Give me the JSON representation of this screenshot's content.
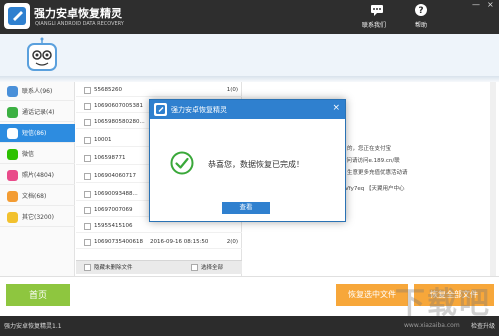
{
  "titlebar": {
    "app_name": "强力安卓恢复精灵",
    "app_subtitle": "QIANGLI ANDROID DATA RECOVERY",
    "contact_label": "联系我们",
    "help_label": "帮助",
    "minimize": "—",
    "close": "×"
  },
  "sidebar": {
    "items": [
      {
        "label": "联系人(96)",
        "icon": "contacts-icon",
        "color": "#4a90d9",
        "active": false
      },
      {
        "label": "通话记录(4)",
        "icon": "call-log-icon",
        "color": "#3cb043",
        "active": false
      },
      {
        "label": "短信(86)",
        "icon": "sms-icon",
        "color": "#ffffff",
        "active": true
      },
      {
        "label": "微信",
        "icon": "wechat-icon",
        "color": "#2dc100",
        "active": false
      },
      {
        "label": "照片(4804)",
        "icon": "photos-icon",
        "color": "#e94b8a",
        "active": false
      },
      {
        "label": "文档(68)",
        "icon": "documents-icon",
        "color": "#f39c33",
        "active": false
      },
      {
        "label": "其它(3200)",
        "icon": "other-icon",
        "color": "#f2c12e",
        "active": false
      }
    ]
  },
  "messages": {
    "rows": [
      {
        "number": "55685260",
        "date": "",
        "count": "1(0)"
      },
      {
        "number": "10690607005381",
        "date": "",
        "count": ""
      },
      {
        "number": "1065980580280...",
        "date": "",
        "count": ""
      },
      {
        "number": "10001",
        "date": "",
        "count": ""
      },
      {
        "number": "106598771",
        "date": "",
        "count": ""
      },
      {
        "number": "106904060717",
        "date": "",
        "count": ""
      },
      {
        "number": "10690093488...",
        "date": "",
        "count": ""
      },
      {
        "number": "10697007069",
        "date": "",
        "count": ""
      },
      {
        "number": "15955415106",
        "date": "",
        "count": ""
      },
      {
        "number": "10690735400618",
        "date": "2016-09-16 08:15:50",
        "count": "2(0)"
      }
    ],
    "footer_hide_deleted": "隐藏未删除文件",
    "footer_select_all": "选择全部"
  },
  "detail": {
    "lines": [
      "的，您正在支付宝",
      "访问请访问e.189.cn/联",
      "生意更多充值优惠活动请",
      "Vfy7eq 【天翼用户中心"
    ]
  },
  "bottom": {
    "home_label": "首页",
    "recover_selected_label": "恢复选中文件",
    "recover_all_label": "恢复全部文件"
  },
  "status": {
    "version": "强力安卓恢复精灵1.1",
    "check_update": "检查升级"
  },
  "watermark": {
    "text": "下载吧",
    "url": "www.xiazaiba.com"
  },
  "dialog": {
    "title": "强力安卓恢复精灵",
    "message": "恭喜您，数据恢复已完成！",
    "button": "查看",
    "close": "×"
  },
  "colors": {
    "titlebar": "#2e2e2e",
    "accent_blue": "#2f80cf",
    "home_green": "#8ec63f",
    "recover_orange": "#f7a73a"
  }
}
